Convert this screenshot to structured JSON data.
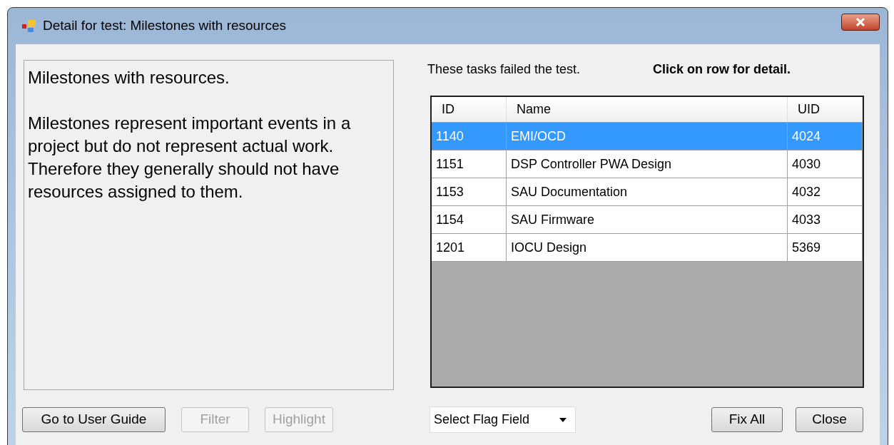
{
  "window": {
    "title": "Detail for test: Milestones with resources"
  },
  "description": {
    "paragraphs": [
      "Milestones with resources.",
      "Milestones represent important events in a project but do not represent actual work. Therefore they generally should not have resources assigned to them."
    ]
  },
  "info_label": "These tasks failed the test.",
  "hint_label": "Click on row for detail.",
  "table": {
    "columns": [
      "ID",
      "Name",
      "UID"
    ],
    "rows": [
      {
        "cells": [
          "1140",
          "EMI/OCD",
          "4024"
        ],
        "selected": true
      },
      {
        "cells": [
          "1151",
          "DSP Controller PWA Design",
          "4030"
        ],
        "selected": false
      },
      {
        "cells": [
          "1153",
          "SAU Documentation",
          "4032"
        ],
        "selected": false
      },
      {
        "cells": [
          "1154",
          "SAU Firmware",
          "4033"
        ],
        "selected": false
      },
      {
        "cells": [
          "1201",
          "IOCU Design",
          "5369"
        ],
        "selected": false
      }
    ]
  },
  "left_buttons": [
    {
      "label": "Go to User Guide",
      "disabled": false
    },
    {
      "label": "Filter",
      "disabled": true
    },
    {
      "label": "Highlight",
      "disabled": true
    }
  ],
  "flag_select": {
    "value": "Select Flag Field"
  },
  "right_buttons": [
    {
      "label": "Fix All",
      "disabled": false
    },
    {
      "label": "Close",
      "disabled": false
    }
  ]
}
